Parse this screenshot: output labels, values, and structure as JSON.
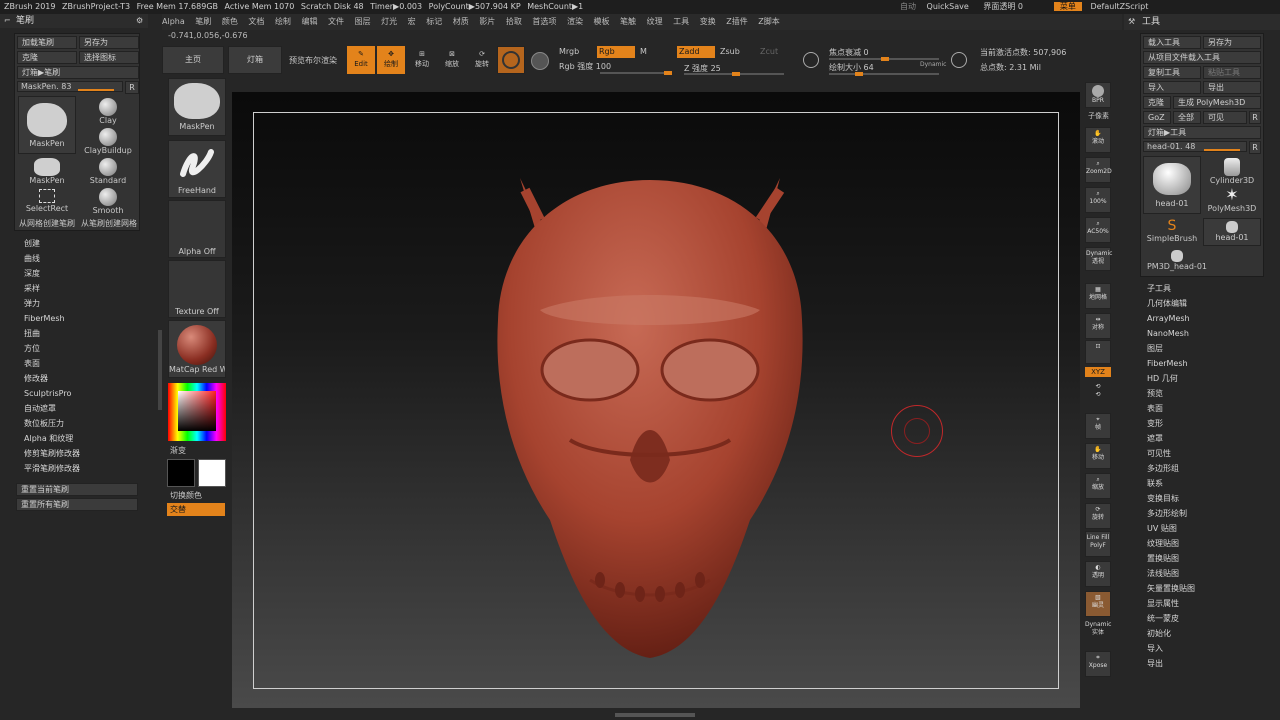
{
  "topbar": {
    "items": [
      "ZBrush 2019",
      "ZBrushProject-T3",
      "Free Mem 17.689GB",
      "Active Mem 1070",
      "Scratch Disk 48",
      "Timer▶0.003",
      "PolyCount▶507.904 KP",
      "MeshCount▶1"
    ],
    "auto": "自动",
    "quicksave": "QuickSave",
    "transparency": "界面透明 0",
    "menu": "菜单",
    "script": "DefaultZScript"
  },
  "menubar": [
    "Alpha",
    "笔刷",
    "颜色",
    "文档",
    "绘制",
    "编辑",
    "文件",
    "图层",
    "灯光",
    "宏",
    "标记",
    "材质",
    "影片",
    "拾取",
    "首选项",
    "渲染",
    "模板",
    "笔触",
    "纹理",
    "工具",
    "变换",
    "Z插件",
    "Z脚本"
  ],
  "coords": "-0.741,0.056,-0.676",
  "brush_panel": {
    "title": "笔刷",
    "load": "加载笔刷",
    "saveas": "另存为",
    "clone": "克隆",
    "select_icon": "选择图标",
    "lightbox": "灯箱▶笔刷",
    "maskpen_slider": "MaskPen. 83",
    "r": "R",
    "brushes": [
      "MaskPen",
      "Clay",
      "ClayBuildup",
      "MaskPen",
      "Standard",
      "SelectRect",
      "Smooth"
    ],
    "from_mesh": "从网格创建笔刷",
    "from_brush": "从笔刷创建网格",
    "sections": [
      "创建",
      "曲线",
      "深度",
      "采样",
      "弹力",
      "FiberMesh",
      "扭曲",
      "方位",
      "表面",
      "修改器",
      "SculptrisPro",
      "自动遮罩",
      "数位板压力",
      "Alpha 和纹理",
      "修剪笔刷修改器",
      "平滑笔刷修改器"
    ],
    "reset_current": "重置当前笔刷",
    "reset_all": "重置所有笔刷"
  },
  "shelf": {
    "maskpen": "MaskPen",
    "freehand": "FreeHand",
    "alpha": "Alpha Off",
    "texture": "Texture Off",
    "matcap": "MatCap Red Wax",
    "gradient": "渐变",
    "switch_color": "切换颜色",
    "alternate": "交替"
  },
  "toolbar": {
    "home": "主页",
    "lightbox": "灯箱",
    "preview": "预览布尔渲染",
    "edit": "Edit",
    "draw": "绘制",
    "move": "移动",
    "scale": "缩放",
    "rotate": "旋转",
    "mrgb": "Mrgb",
    "rgb": "Rgb",
    "m": "M",
    "zadd": "Zadd",
    "zsub": "Zsub",
    "zcut": "Zcut",
    "rgb_intensity": "Rgb 强度 100",
    "z_intensity": "Z 强度 25",
    "focal": "焦点衰减 0",
    "draw_size": "绘制大小 64",
    "dynamic": "Dynamic",
    "active_points": "当前激活点数: 507,906",
    "total_points": "总点数: 2.31 Mil"
  },
  "right_icons": [
    "BPR",
    "子像素",
    "滚动",
    "Zoom2D",
    "100%",
    "AC50%",
    "Dynamic 透视",
    "地网格",
    "对称",
    "XYZ",
    "帧",
    "移动",
    "缩放",
    "旋转",
    "Line Fill PolyF",
    "透明",
    "幽灵",
    "Dynamic 实体",
    "Xpose"
  ],
  "tool_panel": {
    "title": "工具",
    "load": "载入工具",
    "saveas": "另存为",
    "import_project": "从项目文件载入工具",
    "copy": "复制工具",
    "paste": "粘贴工具",
    "import": "导入",
    "export": "导出",
    "clone": "克隆",
    "make_polymesh": "生成 PolyMesh3D",
    "goz": "GoZ",
    "all": "全部",
    "visible": "可见",
    "r": "R",
    "lightbox": "灯箱▶工具",
    "head_slider": "head-01. 48",
    "tools": [
      "head-01",
      "Cylinder3D",
      "PolyMesh3D",
      "SimpleBrush",
      "head-01",
      "PM3D_head-01"
    ],
    "sections": [
      "子工具",
      "几何体编辑",
      "ArrayMesh",
      "NanoMesh",
      "图层",
      "FiberMesh",
      "HD 几何",
      "预览",
      "表面",
      "变形",
      "遮罩",
      "可见性",
      "多边形组",
      "联系",
      "变换目标",
      "多边形绘制",
      "UV 贴图",
      "纹理贴图",
      "置换贴图",
      "法线贴图",
      "矢量置换贴图",
      "显示属性",
      "统一蒙皮",
      "初始化",
      "导入",
      "导出"
    ]
  }
}
